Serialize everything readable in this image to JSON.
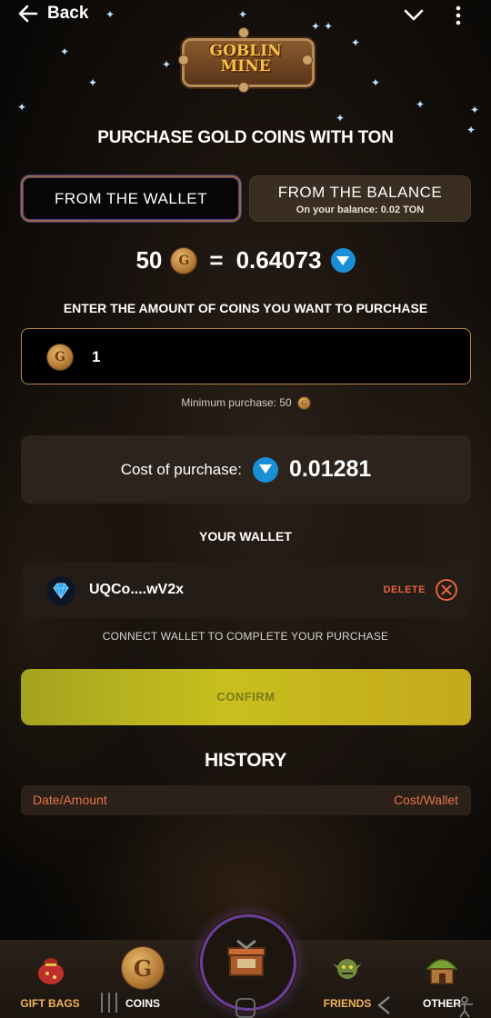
{
  "top_bar": {
    "back_label": "Back"
  },
  "logo": {
    "line1": "GOBLIN",
    "line2": "MINE"
  },
  "page_title": "PURCHASE GOLD COINS WITH TON",
  "tabs": {
    "wallet": "FROM THE WALLET",
    "balance": "FROM THE BALANCE",
    "balance_sub": "On your balance: 0.02 TON"
  },
  "rate": {
    "coins": "50",
    "equals": "=",
    "ton": "0.64073"
  },
  "amount": {
    "label": "ENTER THE AMOUNT OF COINS YOU WANT TO PURCHASE",
    "value": "1",
    "min_text": "Minimum purchase: 50"
  },
  "cost": {
    "label": "Cost of purchase:",
    "value": "0.01281"
  },
  "wallet": {
    "label": "YOUR WALLET",
    "address": "UQCo....wV2x",
    "delete_label": "DELETE",
    "connect_text": "CONNECT WALLET TO COMPLETE YOUR PURCHASE"
  },
  "confirm_label": "CONFIRM",
  "history": {
    "title": "HISTORY",
    "col_left": "Date/Amount",
    "col_right": "Cost/Wallet"
  },
  "nav": {
    "gift_bags": "GIFT BAGS",
    "coins": "COINS",
    "friends": "FRIENDS",
    "other": "OTHER",
    "center_icon": "mine-chest-icon"
  },
  "colors": {
    "accent_orange": "#e4724a",
    "confirm_yellow": "#c8bf1d",
    "ton_blue": "#1b8fd6",
    "gold_border": "#b68a45"
  }
}
